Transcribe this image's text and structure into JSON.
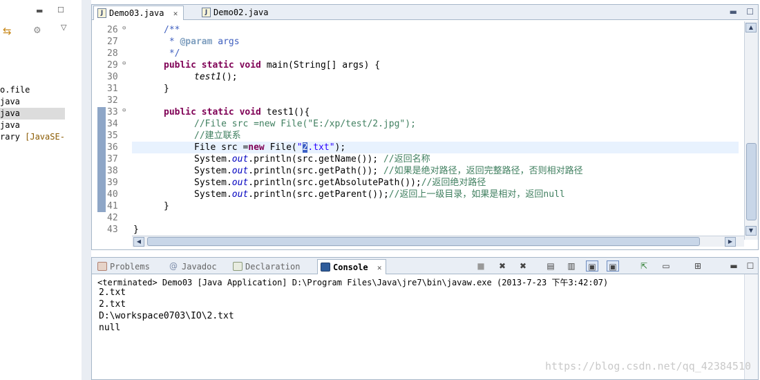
{
  "left_panel": {
    "items": [
      {
        "text": "o.file",
        "selected": false
      },
      {
        "text": "java",
        "selected": false
      },
      {
        "text": "java",
        "selected": true
      },
      {
        "text": "java",
        "selected": false
      },
      {
        "text": "rary ",
        "lib": "[JavaSE-",
        "selected": false
      }
    ]
  },
  "editor": {
    "tabs": [
      {
        "label": "Demo03.java",
        "close": "✕",
        "active": true
      },
      {
        "label": "Demo02.java",
        "active": false
      }
    ],
    "line_numbers": [
      "26",
      "27",
      "28",
      "29",
      "30",
      "31",
      "32",
      "33",
      "34",
      "35",
      "36",
      "37",
      "38",
      "39",
      "40",
      "41",
      "42",
      "43"
    ],
    "fold_marks": {
      "26": "⊖",
      "29": "⊖",
      "33": "⊖"
    },
    "code": {
      "l26": "/**",
      "l27_star": " * ",
      "l27_tag": "@param",
      "l27_arg": " args",
      "l28": " */",
      "l29_kw": "public static void",
      "l29_rest": " main(String[] args) {",
      "l30_call": "test1",
      "l30_rest": "();",
      "l31": "}",
      "l33_kw": "public static void",
      "l33_rest": " test1(){",
      "l34": "//File src =new File(\"E:/xp/test/2.jpg\");",
      "l35": "//建立联系",
      "l36_a": "File src =",
      "l36_kw": "new",
      "l36_b": " File(",
      "l36_str_open": "\"",
      "l36_str_caret": "2",
      "l36_str_rest": ".txt\"",
      "l36_end": ");",
      "l37_a": "System.",
      "l37_fld": "out",
      "l37_b": ".println(src.getName()); ",
      "l37_cm": "//返回名称",
      "l38_a": "System.",
      "l38_fld": "out",
      "l38_b": ".println(src.getPath()); ",
      "l38_cm": "//如果是绝对路径，返回完整路径，否则相对路径",
      "l39_a": "System.",
      "l39_fld": "out",
      "l39_b": ".println(src.getAbsolutePath());",
      "l39_cm": "//返回绝对路径",
      "l40_a": "System.",
      "l40_fld": "out",
      "l40_b": ".println(src.getParent());",
      "l40_cm": "//返回上一级目录，如果是相对，返回null",
      "l41": "}",
      "l43": "}"
    }
  },
  "console": {
    "tabs": [
      {
        "label": "Problems",
        "icon": "problems-icon",
        "active": false
      },
      {
        "label": "Javadoc",
        "icon": "at-icon",
        "active": false
      },
      {
        "label": "Declaration",
        "icon": "declaration-icon",
        "active": false
      },
      {
        "label": "Console",
        "icon": "console-icon",
        "close": "✕",
        "active": true
      }
    ],
    "terminated_line": "<terminated> Demo03 [Java Application] D:\\Program Files\\Java\\jre7\\bin\\javaw.exe (2013-7-23 下午3:42:07)",
    "output": [
      "2.txt",
      "2.txt",
      "D:\\workspace0703\\IO\\2.txt",
      "null"
    ],
    "watermark": "https://blog.csdn.net/qq_42384510"
  },
  "colors": {
    "keyword": "#7f0055",
    "comment": "#3f7f5f",
    "string": "#2a00ff",
    "field": "#0000c0",
    "javadoc": "#3f5fbf"
  }
}
